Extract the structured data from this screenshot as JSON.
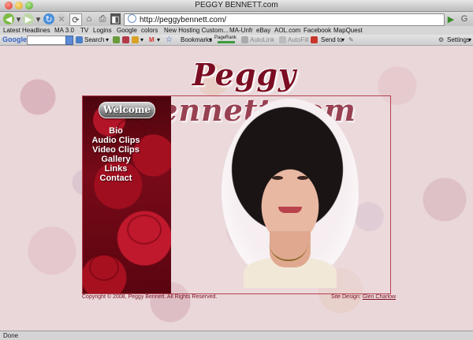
{
  "window": {
    "title": "PEGGY BENNETT.com"
  },
  "navigation": {
    "url": "http://peggybennett.com/"
  },
  "bookmarks": [
    "Latest Headlines",
    "MA 3.0",
    "TV",
    "Logins",
    "Google",
    "colors",
    "New Hosting Custom...",
    "MA-Unfr",
    "eBay",
    "AOL.com",
    "Facebook",
    "MapQuest"
  ],
  "google_toolbar": {
    "logo": "Google",
    "search_label": "Search",
    "bookmarks_label": "Bookmarks",
    "pagerank_label": "PageRank",
    "autolink_label": "AutoLink",
    "autofill_label": "AutoFill",
    "sendto_label": "Send to",
    "settings_label": "Settings"
  },
  "site": {
    "title": "Peggy Bennett.com",
    "welcome": "Welcome",
    "menu": [
      "Bio",
      "Audio Clips",
      "Video Clips",
      "Gallery",
      "Links",
      "Contact"
    ],
    "copyright": "Copyright © 2008, Peggy Bennett. All Rights Reserved.",
    "credit_prefix": "Site Design:",
    "credit_name": "Glen Charlow"
  },
  "status": {
    "text": "Done"
  }
}
